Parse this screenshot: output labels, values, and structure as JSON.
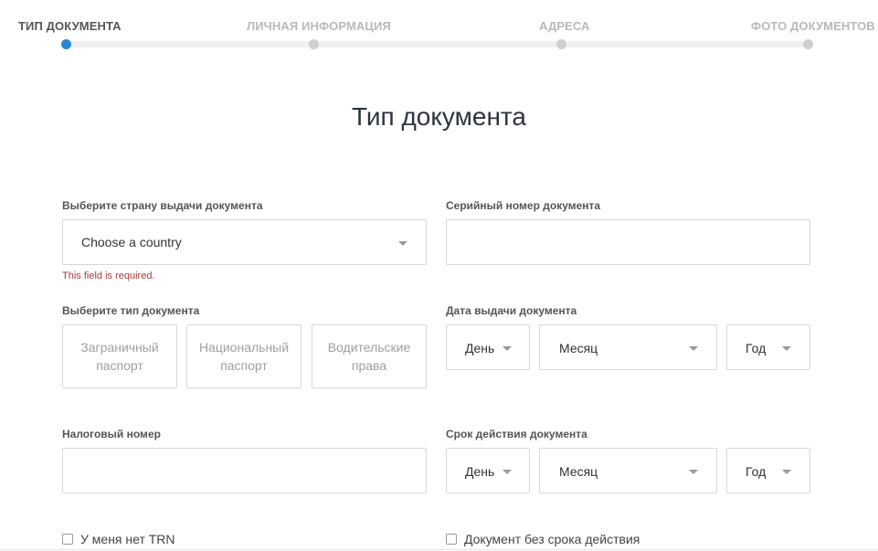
{
  "stepper": {
    "steps": [
      {
        "label": "Тип документа",
        "active": true
      },
      {
        "label": "Личная информация",
        "active": false
      },
      {
        "label": "Адреса",
        "active": false
      },
      {
        "label": "Фото документов",
        "active": false
      }
    ]
  },
  "title": "Тип документа",
  "form": {
    "country": {
      "label": "Выберите страну выдачи документа",
      "value": "Choose a country",
      "error": "This field is required."
    },
    "serial": {
      "label": "Серийный номер документа",
      "value": ""
    },
    "doc_type": {
      "label": "Выберите тип документа",
      "options": [
        "Заграничный паспорт",
        "Национальный паспорт",
        "Водительские права"
      ]
    },
    "issue_date": {
      "label": "Дата выдачи документа",
      "day": "День",
      "month": "Месяц",
      "year": "Год"
    },
    "tax": {
      "label": "Налоговый номер",
      "value": ""
    },
    "expiry_date": {
      "label": "Срок действия документа",
      "day": "День",
      "month": "Месяц",
      "year": "Год"
    },
    "no_trn": {
      "label": "У меня нет TRN",
      "checked": false
    },
    "no_expiry": {
      "label": "Документ без срока действия",
      "checked": false
    }
  }
}
